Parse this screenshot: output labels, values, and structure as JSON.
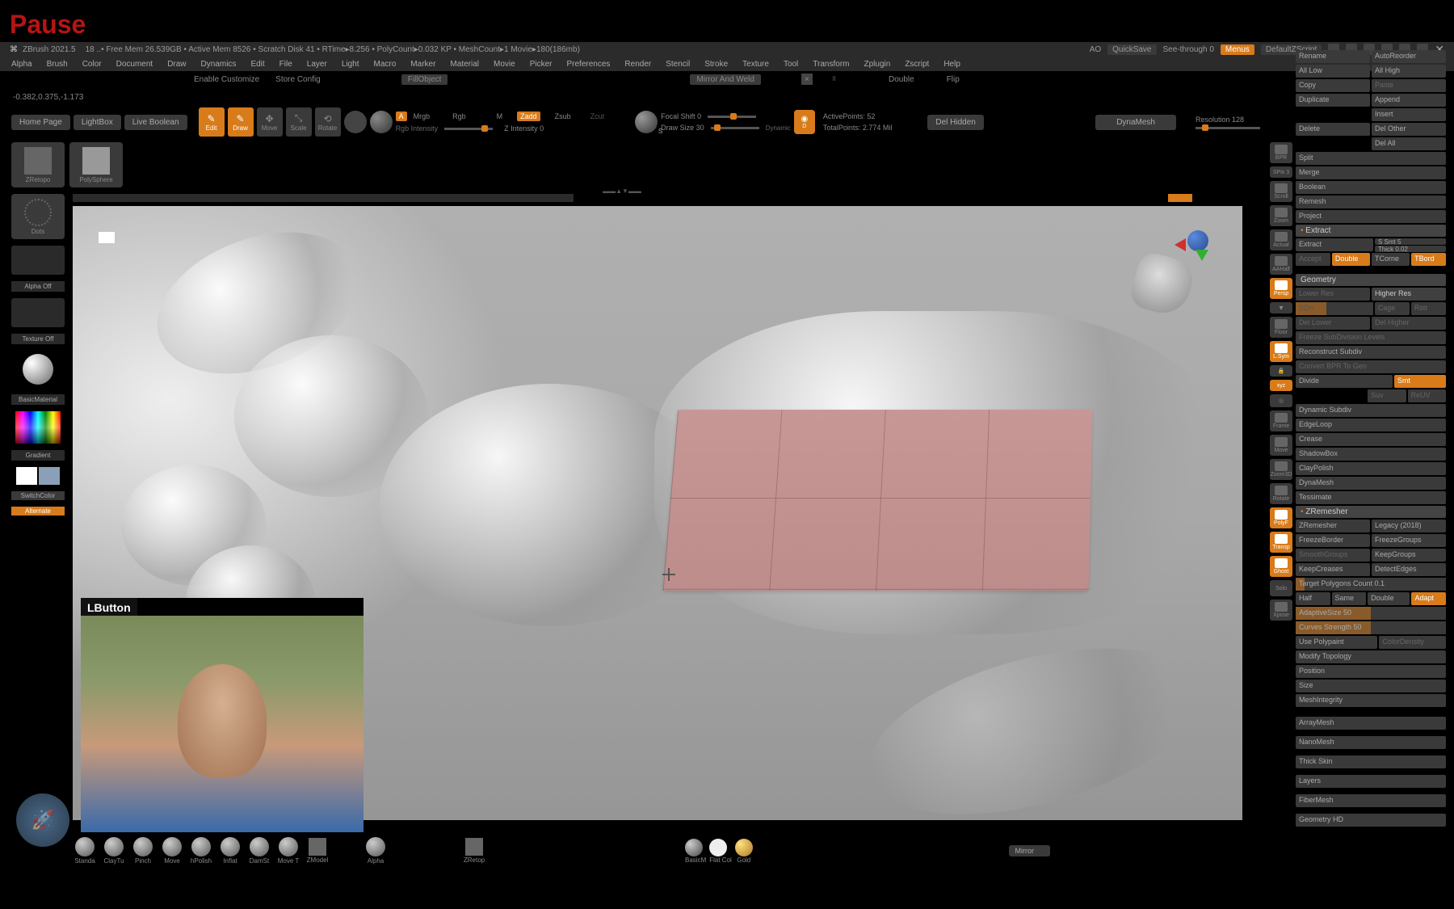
{
  "overlay": {
    "pause": "Pause"
  },
  "titlebar": {
    "app": "ZBrush 2021.5",
    "stats": "18   ..• Free Mem 26.539GB • Active Mem 8526 • Scratch Disk 41 •   RTime▸8.256 • PolyCount▸0.032 KP • MeshCount▸1   Movie▸180(186mb)",
    "ao": "AO",
    "quicksave": "QuickSave",
    "seethrough": "See-through   0",
    "menus": "Menus",
    "defaultscript": "DefaultZScript"
  },
  "menubar": {
    "items": [
      "Alpha",
      "Brush",
      "Color",
      "Document",
      "Draw",
      "Dynamics",
      "Edit",
      "File",
      "Layer",
      "Light",
      "Macro",
      "Marker",
      "Material",
      "Movie",
      "Picker",
      "Preferences",
      "Render",
      "Stencil",
      "Stroke",
      "Texture",
      "Tool",
      "Transform",
      "Zplugin",
      "Zscript",
      "Help"
    ]
  },
  "right_menu": {
    "items": [
      "Rename",
      "AutoReorder",
      "All Low",
      "All High",
      "Copy",
      "",
      "Duplicate",
      "Append",
      "",
      "Insert",
      "Delete",
      "Del Other",
      "",
      "Del All",
      "Split",
      "Merge",
      "Boolean",
      "Remesh",
      "Project"
    ]
  },
  "configbar": {
    "enable_customize": "Enable Customize",
    "store_config": "Store Config",
    "fillobject": "FillObject",
    "mirror_weld": "Mirror And Weld",
    "double": "Double",
    "flip": "Flip"
  },
  "coord": "-0.382,0.375,-1.173",
  "toolbar": {
    "homepage": "Home Page",
    "lightbox": "LightBox",
    "liveboolean": "Live Boolean",
    "edit": "Edit",
    "draw": "Draw",
    "move": "Move",
    "scale": "Scale",
    "rotate": "Rotate",
    "a": "A",
    "mrgb": "Mrgb",
    "rgb": "Rgb",
    "m": "M",
    "zadd": "Zadd",
    "zsub": "Zsub",
    "zcut": "Zcut",
    "rgb_intensity": "Rgb Intensity",
    "z_intensity": "Z Intensity  0",
    "focal_shift": "Focal Shift 0",
    "draw_size": "Draw Size  30",
    "dynamic": "Dynamic",
    "active_points": "ActivePoints: 52",
    "total_points": "TotalPoints: 2.774 Mil",
    "del_hidden": "Del Hidden",
    "dynamesh": "DynaMesh",
    "resolution": "Resolution 128"
  },
  "left": {
    "zretopo": "ZRetopo",
    "polysphere": "PolySphere",
    "dots": "Dots",
    "alpha_off": "Alpha Off",
    "texture_off": "Texture Off",
    "basicmaterial": "BasicMaterial",
    "gradient": "Gradient",
    "switchcolor": "SwitchColor",
    "alternate": "Alternate"
  },
  "right_tools": {
    "bpr": "BPR",
    "spix": "SPix  3",
    "scroll": "Scroll",
    "zoom": "Zoom",
    "actual": "Actual",
    "aahalf": "AAHalf",
    "persp": "Persp",
    "floor": "Floor",
    "lsym": "L.Sym",
    "xyz": "xyz",
    "frame": "Frame",
    "move2": "Move",
    "zoom3d": "Zoom3D",
    "rotate2": "Rotate",
    "polyf": "PolyF",
    "transp": "Transp",
    "ghost": "Ghost",
    "solo": "Solo",
    "xpose": "Xpose"
  },
  "extract_panel": {
    "header": "Extract",
    "extract": "Extract",
    "ssmt": "S Smt  5",
    "thick": "Thick 0.02",
    "accept": "Accept",
    "double": "Double",
    "tcorne": "TCorne",
    "tbord": "TBord"
  },
  "geometry": {
    "header": "Geometry",
    "lower_res": "Lower Res",
    "higher_res": "Higher Res",
    "sdiv": "SDiv",
    "cage": "Cage",
    "rstr": "Rstr",
    "del_lower": "Del Lower",
    "del_higher": "Del Higher",
    "freeze": "Freeze SubDivision Levels",
    "reconstruct": "Reconstruct Subdiv",
    "convert_bpr": "Convert BPR To Geo",
    "divide": "Divide",
    "smt": "Smt",
    "suv": "Suv",
    "reuv": "ReUV",
    "dynamic_subdiv": "Dynamic Subdiv",
    "edgeloop": "EdgeLoop",
    "crease": "Crease",
    "shadowbox": "ShadowBox",
    "claypolish": "ClayPolish",
    "dynamesh": "DynaMesh",
    "tessimate": "Tessimate",
    "zremesher_head": "ZRemesher",
    "zremesher": "ZRemesher",
    "legacy": "Legacy (2018)",
    "freezeborder": "FreezeBorder",
    "freezegroups": "FreezeGroups",
    "smoothgroups": "SmoothGroups",
    "keepgroups": "KeepGroups",
    "keepcreases": "KeepCreases",
    "detectedges": "DetectEdges",
    "target_poly": "Target Polygons Count 0.1",
    "half": "Half",
    "same": "Same",
    "double2": "Double",
    "adapt": "Adapt",
    "adaptive": "AdaptiveSize 50",
    "curves": "Curves Strength 50",
    "use_poly": "Use Polypaint",
    "colordensity": "ColorDensity",
    "modify_topo": "Modify Topology",
    "position": "Position",
    "size": "Size",
    "meshintegrity": "MeshIntegrity",
    "arraymesh": "ArrayMesh",
    "nanomesh": "NanoMesh",
    "thick_skin": "Thick Skin",
    "layers": "Layers",
    "fibermesh": "FiberMesh",
    "geometry_hd": "Geometry HD"
  },
  "webcam": {
    "label": "LButton"
  },
  "bottom": {
    "brushes": [
      "Standa",
      "ClayTu",
      "Pinch",
      "Move",
      "hPolish",
      "Inflat",
      "DamSt",
      "Move T",
      "ZModel",
      "",
      "Alpha",
      "",
      "ZRetop"
    ],
    "materials": [
      "BasicM",
      "Flat Col",
      "Gold"
    ],
    "mirror": "Mirror"
  }
}
